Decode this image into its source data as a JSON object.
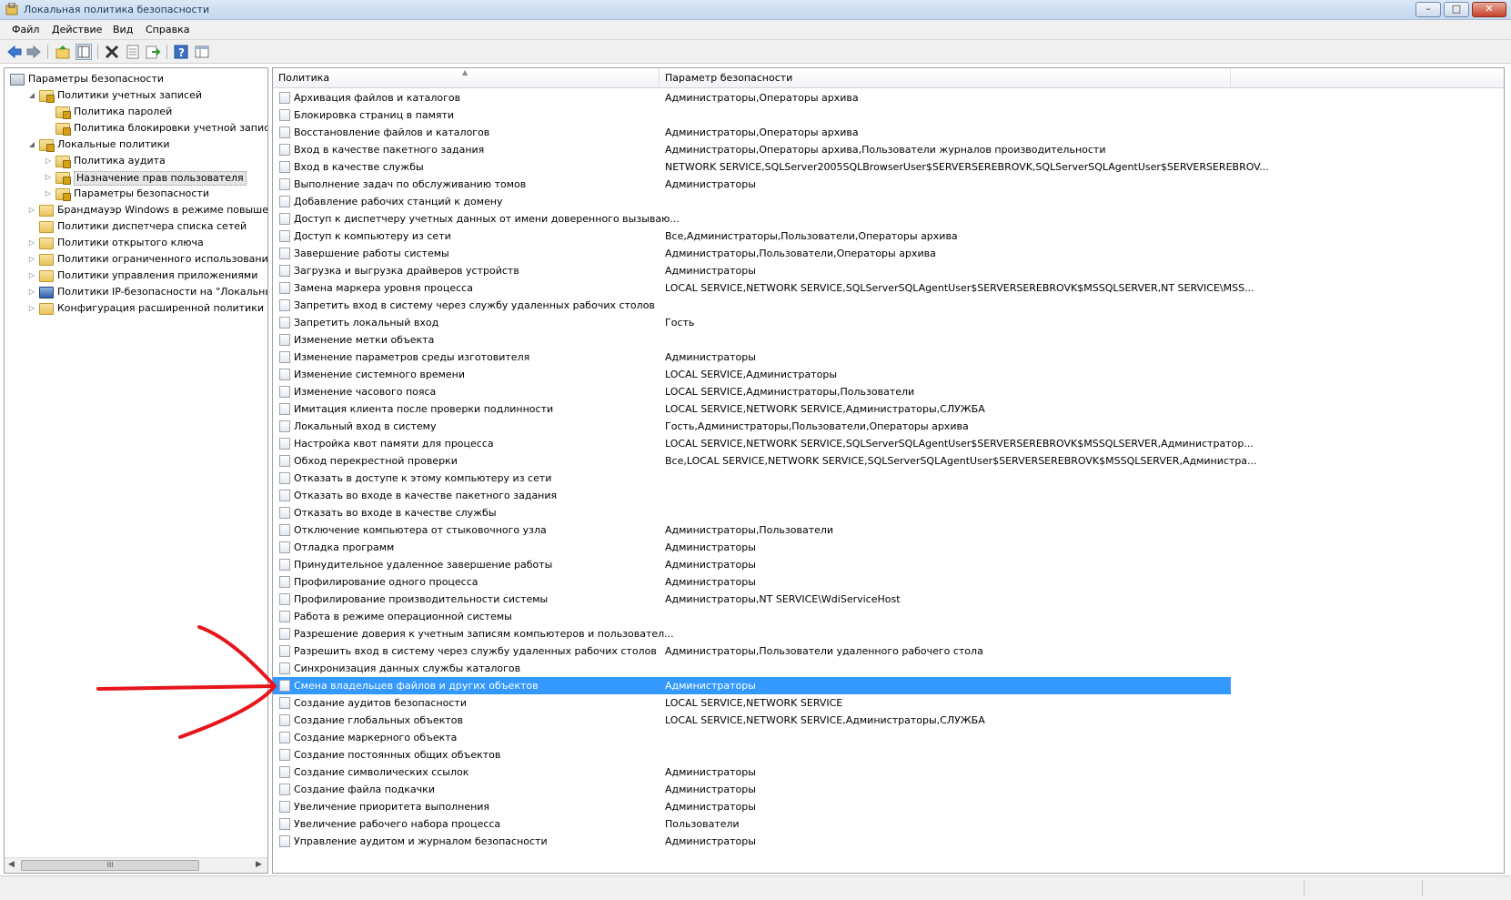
{
  "window": {
    "title": "Локальная политика безопасности"
  },
  "menu": [
    "Файл",
    "Действие",
    "Вид",
    "Справка"
  ],
  "toolbar_icons": [
    "back-arrow-icon",
    "forward-arrow-icon",
    "up-folder-icon",
    "show-tree-icon",
    "delete-icon",
    "properties-icon",
    "export-icon",
    "help-icon",
    "console-icon"
  ],
  "tree": [
    {
      "label": "Параметры безопасности",
      "level": 0,
      "expander": "",
      "icon": "security-settings-icon"
    },
    {
      "label": "Политики учетных записей",
      "level": 1,
      "expander": "◢",
      "icon": "lock-folder-icon"
    },
    {
      "label": "Политика паролей",
      "level": 2,
      "expander": "",
      "icon": "lock-folder-icon"
    },
    {
      "label": "Политика блокировки учетной записи",
      "level": 2,
      "expander": "",
      "icon": "lock-folder-icon"
    },
    {
      "label": "Локальные политики",
      "level": 1,
      "expander": "◢",
      "icon": "lock-folder-icon"
    },
    {
      "label": "Политика аудита",
      "level": 2,
      "expander": "▷",
      "icon": "lock-folder-icon"
    },
    {
      "label": "Назначение прав пользователя",
      "level": 2,
      "expander": "▷",
      "icon": "lock-folder-icon",
      "selected": true
    },
    {
      "label": "Параметры безопасности",
      "level": 2,
      "expander": "▷",
      "icon": "lock-folder-icon"
    },
    {
      "label": "Брандмауэр Windows в режиме повышенно",
      "level": 1,
      "expander": "▷",
      "icon": "folder-icon"
    },
    {
      "label": "Политики диспетчера списка сетей",
      "level": 1,
      "expander": "",
      "icon": "folder-icon"
    },
    {
      "label": "Политики открытого ключа",
      "level": 1,
      "expander": "▷",
      "icon": "folder-icon"
    },
    {
      "label": "Политики ограниченного использования пр",
      "level": 1,
      "expander": "▷",
      "icon": "folder-icon"
    },
    {
      "label": "Политики управления приложениями",
      "level": 1,
      "expander": "▷",
      "icon": "folder-icon"
    },
    {
      "label": "Политики IP-безопасности на \"Локальный к",
      "level": 1,
      "expander": "▷",
      "icon": "ipsec-icon"
    },
    {
      "label": "Конфигурация расширенной политики ауди",
      "level": 1,
      "expander": "▷",
      "icon": "folder-icon"
    }
  ],
  "tree_scroll_grip": "III",
  "list": {
    "columns": [
      "Политика",
      "Параметр безопасности"
    ],
    "rows": [
      {
        "policy": "Архивация файлов и каталогов",
        "value": "Администраторы,Операторы архива"
      },
      {
        "policy": "Блокировка страниц в памяти",
        "value": ""
      },
      {
        "policy": "Восстановление файлов и каталогов",
        "value": "Администраторы,Операторы архива"
      },
      {
        "policy": "Вход в качестве пакетного задания",
        "value": "Администраторы,Операторы архива,Пользователи журналов производительности"
      },
      {
        "policy": "Вход в качестве службы",
        "value": "NETWORK SERVICE,SQLServer2005SQLBrowserUser$SERVERSEREBROVK,SQLServerSQLAgentUser$SERVERSEREBROV..."
      },
      {
        "policy": "Выполнение задач по обслуживанию томов",
        "value": "Администраторы"
      },
      {
        "policy": "Добавление рабочих станций к домену",
        "value": ""
      },
      {
        "policy": "Доступ к диспетчеру учетных данных от имени доверенного вызываю...",
        "value": ""
      },
      {
        "policy": "Доступ к компьютеру из сети",
        "value": "Все,Администраторы,Пользователи,Операторы архива"
      },
      {
        "policy": "Завершение работы системы",
        "value": "Администраторы,Пользователи,Операторы архива"
      },
      {
        "policy": "Загрузка и выгрузка драйверов устройств",
        "value": "Администраторы"
      },
      {
        "policy": "Замена маркера уровня процесса",
        "value": "LOCAL SERVICE,NETWORK SERVICE,SQLServerSQLAgentUser$SERVERSEREBROVK$MSSQLSERVER,NT SERVICE\\MSS..."
      },
      {
        "policy": "Запретить вход в систему через службу удаленных рабочих столов",
        "value": ""
      },
      {
        "policy": "Запретить локальный вход",
        "value": "Гость"
      },
      {
        "policy": "Изменение метки объекта",
        "value": ""
      },
      {
        "policy": "Изменение параметров среды изготовителя",
        "value": "Администраторы"
      },
      {
        "policy": "Изменение системного времени",
        "value": "LOCAL SERVICE,Администраторы"
      },
      {
        "policy": "Изменение часового пояса",
        "value": "LOCAL SERVICE,Администраторы,Пользователи"
      },
      {
        "policy": "Имитация клиента после проверки подлинности",
        "value": "LOCAL SERVICE,NETWORK SERVICE,Администраторы,СЛУЖБА"
      },
      {
        "policy": "Локальный вход в систему",
        "value": "Гость,Администраторы,Пользователи,Операторы архива"
      },
      {
        "policy": "Настройка квот памяти для процесса",
        "value": "LOCAL SERVICE,NETWORK SERVICE,SQLServerSQLAgentUser$SERVERSEREBROVK$MSSQLSERVER,Администратор..."
      },
      {
        "policy": "Обход перекрестной проверки",
        "value": "Все,LOCAL SERVICE,NETWORK SERVICE,SQLServerSQLAgentUser$SERVERSEREBROVK$MSSQLSERVER,Администра..."
      },
      {
        "policy": "Отказать в доступе к этому компьютеру из сети",
        "value": ""
      },
      {
        "policy": "Отказать во входе в качестве пакетного задания",
        "value": ""
      },
      {
        "policy": "Отказать во входе в качестве службы",
        "value": ""
      },
      {
        "policy": "Отключение компьютера от стыковочного узла",
        "value": "Администраторы,Пользователи"
      },
      {
        "policy": "Отладка программ",
        "value": "Администраторы"
      },
      {
        "policy": "Принудительное удаленное завершение работы",
        "value": "Администраторы"
      },
      {
        "policy": "Профилирование одного процесса",
        "value": "Администраторы"
      },
      {
        "policy": "Профилирование производительности системы",
        "value": "Администраторы,NT SERVICE\\WdiServiceHost"
      },
      {
        "policy": "Работа в режиме операционной системы",
        "value": ""
      },
      {
        "policy": "Разрешение доверия к учетным записям компьютеров и пользовател...",
        "value": ""
      },
      {
        "policy": "Разрешить вход в систему через службу удаленных рабочих столов",
        "value": "Администраторы,Пользователи удаленного рабочего стола"
      },
      {
        "policy": "Синхронизация данных службы каталогов",
        "value": ""
      },
      {
        "policy": "Смена владельцев файлов и других объектов",
        "value": "Администраторы",
        "selected": true
      },
      {
        "policy": "Создание аудитов безопасности",
        "value": "LOCAL SERVICE,NETWORK SERVICE"
      },
      {
        "policy": "Создание глобальных объектов",
        "value": "LOCAL SERVICE,NETWORK SERVICE,Администраторы,СЛУЖБА"
      },
      {
        "policy": "Создание маркерного объекта",
        "value": ""
      },
      {
        "policy": "Создание постоянных общих объектов",
        "value": ""
      },
      {
        "policy": "Создание символических ссылок",
        "value": "Администраторы"
      },
      {
        "policy": "Создание файла подкачки",
        "value": "Администраторы"
      },
      {
        "policy": "Увеличение приоритета выполнения",
        "value": "Администраторы"
      },
      {
        "policy": "Увеличение рабочего набора процесса",
        "value": "Пользователи"
      },
      {
        "policy": "Управление аудитом и журналом безопасности",
        "value": "Администраторы"
      }
    ]
  },
  "colors": {
    "selection": "#3399ff",
    "annotation": "#e8141c"
  }
}
